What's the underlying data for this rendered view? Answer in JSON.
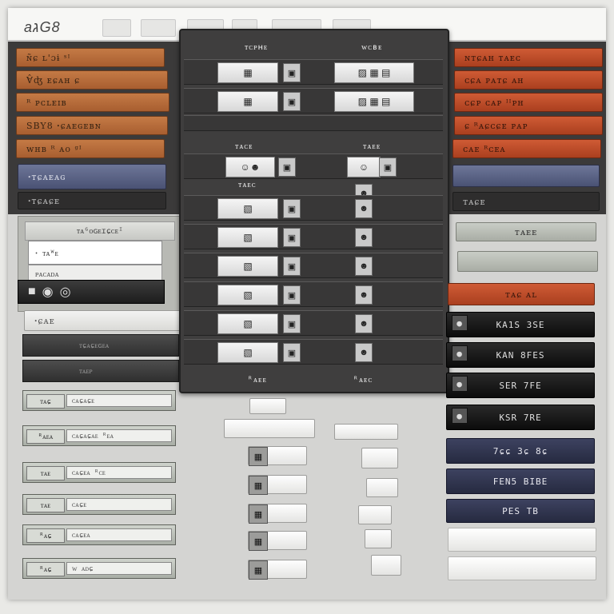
{
  "app": {
    "title": "aגG8"
  },
  "left_menu": {
    "orange_buttons": [
      "ɴ̃ɕ ʟ'ɔɨ ˢᴵ",
      "Ɐ̂ʤ ᴇɕᴀʜ ɕ",
      "ᴿ ᴘᴄʟᴇɪʙ",
      "SBY8 ꞏɕᴀᴇɢᴇʙɴ",
      "ᴡʜʙ ᴿ ᴀᴏ ᵍᴵ"
    ],
    "slate_button": "ꞏᴛɕᴀᴇᴀɢ",
    "dark_button": "ꞏᴛɕᴀɕᴇ",
    "panel_header": "ᴛᴀᴳᴏɢᴇɪɕᴄᴇᴵ",
    "panel_field": "ꞏ ᴛᴀᵂᴇ",
    "panel_sub": "ᴘᴀᴄᴀᴅᴀ",
    "player_icons": [
      "■",
      "◉",
      "◎"
    ],
    "slabs": [
      "ꞏɕᴀᴇ",
      "ᴛɕᴀɕᴇɢᴇᴀ",
      "ᴛᴀᴇᴘ"
    ],
    "rows": [
      {
        "tag": "ᴛᴀɕ",
        "value": "ᴄᴀɕᴀɕᴇ"
      },
      {
        "tag": "ᴿᴀᴇᴀ",
        "value": "ᴄᴀɕᴀɕᴀᴇ ᴿᴇᴀ"
      },
      {
        "tag": "ᴛᴀᴇ",
        "value": "ᴄᴀɕᴇᴀ ᴿᴄᴇ"
      },
      {
        "tag": "ᴛᴀᴇ",
        "value": "ᴄᴀɕᴇ"
      },
      {
        "tag": "ᴿᴀɕ",
        "value": "ᴄᴀɕᴇᴀ"
      },
      {
        "tag": "ᴿᴀɕ",
        "value": "ᴡ ᴀᴅɕ"
      }
    ]
  },
  "center_panel": {
    "column_headers": [
      "ᴛᴄᴘʜᴇ",
      "ᴡᴄʙᴇ"
    ],
    "section_headers": [
      "ᴛᴀᴄᴇ",
      "ᴛᴀᴇᴇ"
    ],
    "mid_label": "ᴛᴀᴇᴄ",
    "footer_headers": [
      "ᴿᴀᴇᴇ",
      "ᴿᴀᴇᴄ"
    ]
  },
  "right_menu": {
    "red_buttons": [
      "ɴᴛɕᴀʜ ᴛᴀᴇᴄ",
      "ᴄɕᴀ ᴘᴀᴛɕ ᴀʜ",
      "ᴄɕᴘ ᴄᴀᴘ ᴵᴵᴘʜ",
      "ɕ ᴿᴀɕᴄɕᴇ ᴘᴀᴘ",
      "ᴄᴀᴇ ᴿᴄᴇᴀ"
    ],
    "slate_button": "",
    "dark_button": "ᴛᴀɕᴇ",
    "sage_buttons": [
      "ᴛᴀᴇᴇ",
      ""
    ],
    "orange_strip": "ᴛᴀɕ ᴀʟ",
    "black_buttons": [
      "KA1S 3SE",
      "KAN 8FES",
      "SER 7FE",
      "KSR 7RE"
    ],
    "navy_buttons": [
      "7ɕɕ 3ɕ 8ɕ",
      "FEN5 BIBE",
      "PES TB"
    ]
  },
  "colors": {
    "background": "#d4d4d2",
    "dark_band": "#3b3a3a",
    "orange": "#b8693a",
    "red": "#c04a28",
    "slate": "#5b6384",
    "navy": "#323651",
    "black": "#151515",
    "sage": "#b5b9b1"
  }
}
